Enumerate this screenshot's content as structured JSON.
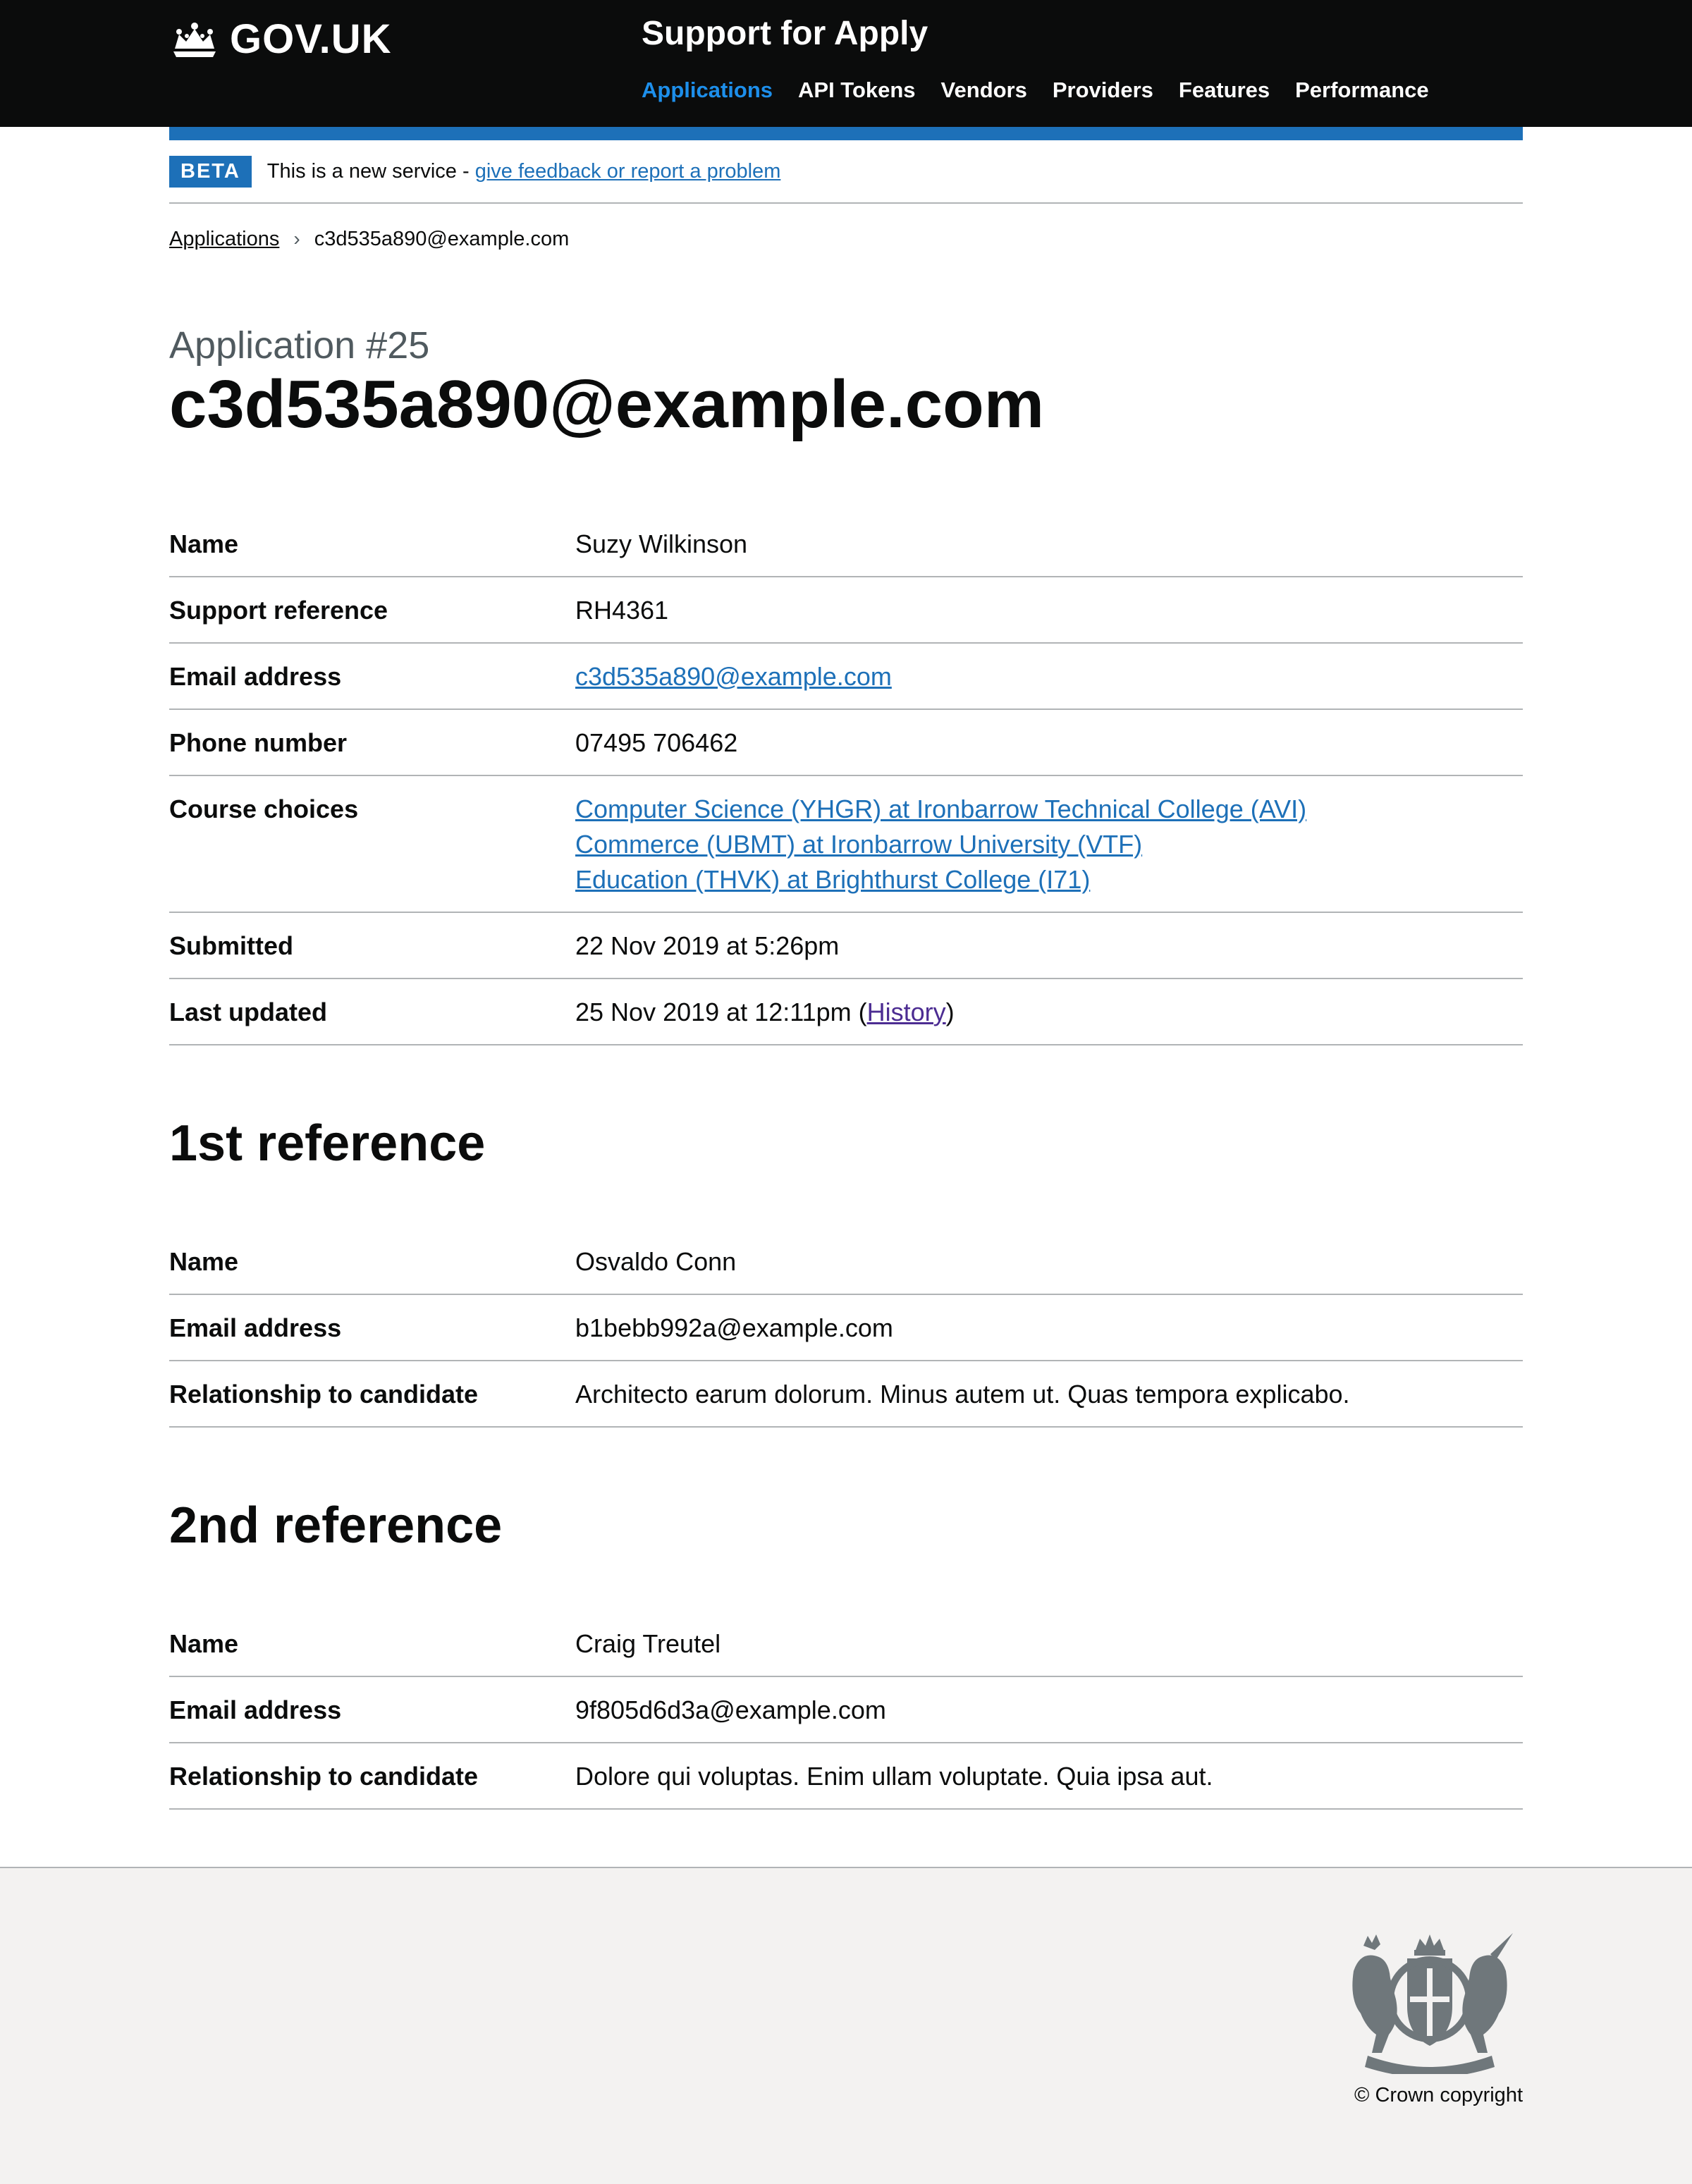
{
  "header": {
    "logo_text": "GOV.UK",
    "service_name": "Support for Apply",
    "nav": [
      "Applications",
      "API Tokens",
      "Vendors",
      "Providers",
      "Features",
      "Performance"
    ],
    "active_nav": "Applications"
  },
  "phase_banner": {
    "tag": "BETA",
    "text": "This is a new service - ",
    "link": "give feedback or report a problem"
  },
  "breadcrumb": {
    "parent": "Applications",
    "current": "c3d535a890@example.com"
  },
  "page": {
    "caption": "Application #25",
    "title": "c3d535a890@example.com"
  },
  "application": {
    "name_label": "Name",
    "name": "Suzy Wilkinson",
    "support_ref_label": "Support reference",
    "support_ref": "RH4361",
    "email_label": "Email address",
    "email": "c3d535a890@example.com",
    "phone_label": "Phone number",
    "phone": "07495 706462",
    "courses_label": "Course choices",
    "courses": [
      "Computer Science (YHGR) at Ironbarrow Technical College (AVI)",
      "Commerce (UBMT) at Ironbarrow University (VTF)",
      "Education (THVK) at Brighthurst College (I71)"
    ],
    "submitted_label": "Submitted",
    "submitted": "22 Nov 2019 at 5:26pm",
    "updated_label": "Last updated",
    "updated": "25 Nov 2019 at 12:11pm (",
    "history_link": "History",
    "updated_close": ")"
  },
  "reference1": {
    "heading": "1st reference",
    "name_label": "Name",
    "name": "Osvaldo Conn",
    "email_label": "Email address",
    "email": "b1bebb992a@example.com",
    "relationship_label": "Relationship to candidate",
    "relationship": "Architecto earum dolorum. Minus autem ut. Quas tempora explicabo."
  },
  "reference2": {
    "heading": "2nd reference",
    "name_label": "Name",
    "name": "Craig Treutel",
    "email_label": "Email address",
    "email": "9f805d6d3a@example.com",
    "relationship_label": "Relationship to candidate",
    "relationship": "Dolore qui voluptas. Enim ullam voluptate. Quia ipsa aut."
  },
  "footer": {
    "copyright": "© Crown copyright",
    "crest_icon": "royal-coat-of-arms-icon"
  },
  "colors": {
    "header_bg": "#0b0c0c",
    "link": "#1d70b8",
    "nav_active": "#1d8feb",
    "visited": "#4c2c92",
    "footer_bg": "#f3f2f1"
  }
}
